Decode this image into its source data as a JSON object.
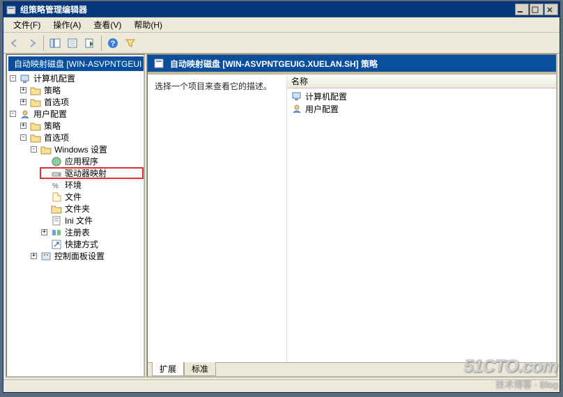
{
  "window": {
    "title": "组策略管理编辑器"
  },
  "menu": {
    "file": "文件(F)",
    "action": "操作(A)",
    "view": "查看(V)",
    "help": "帮助(H)"
  },
  "tree_header": "自动映射磁盘 [WIN-ASVPNTGEUI",
  "tree": {
    "computer_config": "计算机配置",
    "policies": "策略",
    "preferences": "首选项",
    "user_config": "用户配置",
    "windows_settings": "Windows 设置",
    "applications": "应用程序",
    "drive_maps": "驱动器映射",
    "environment": "环境",
    "files": "文件",
    "folders": "文件夹",
    "ini_files": "Ini 文件",
    "registry": "注册表",
    "shortcuts": "快捷方式",
    "control_panel": "控制面板设置"
  },
  "detail": {
    "header": "自动映射磁盘 [WIN-ASVPNTGEUIG.XUELAN.SH] 策略",
    "description": "选择一个项目来查看它的描述。",
    "column_name": "名称",
    "items": {
      "computer_config": "计算机配置",
      "user_config": "用户配置"
    }
  },
  "tabs": {
    "extended": "扩展",
    "standard": "标准"
  },
  "watermark": {
    "line1": "51CTO.com",
    "line2": "技术博客",
    "line2b": "Blog"
  }
}
